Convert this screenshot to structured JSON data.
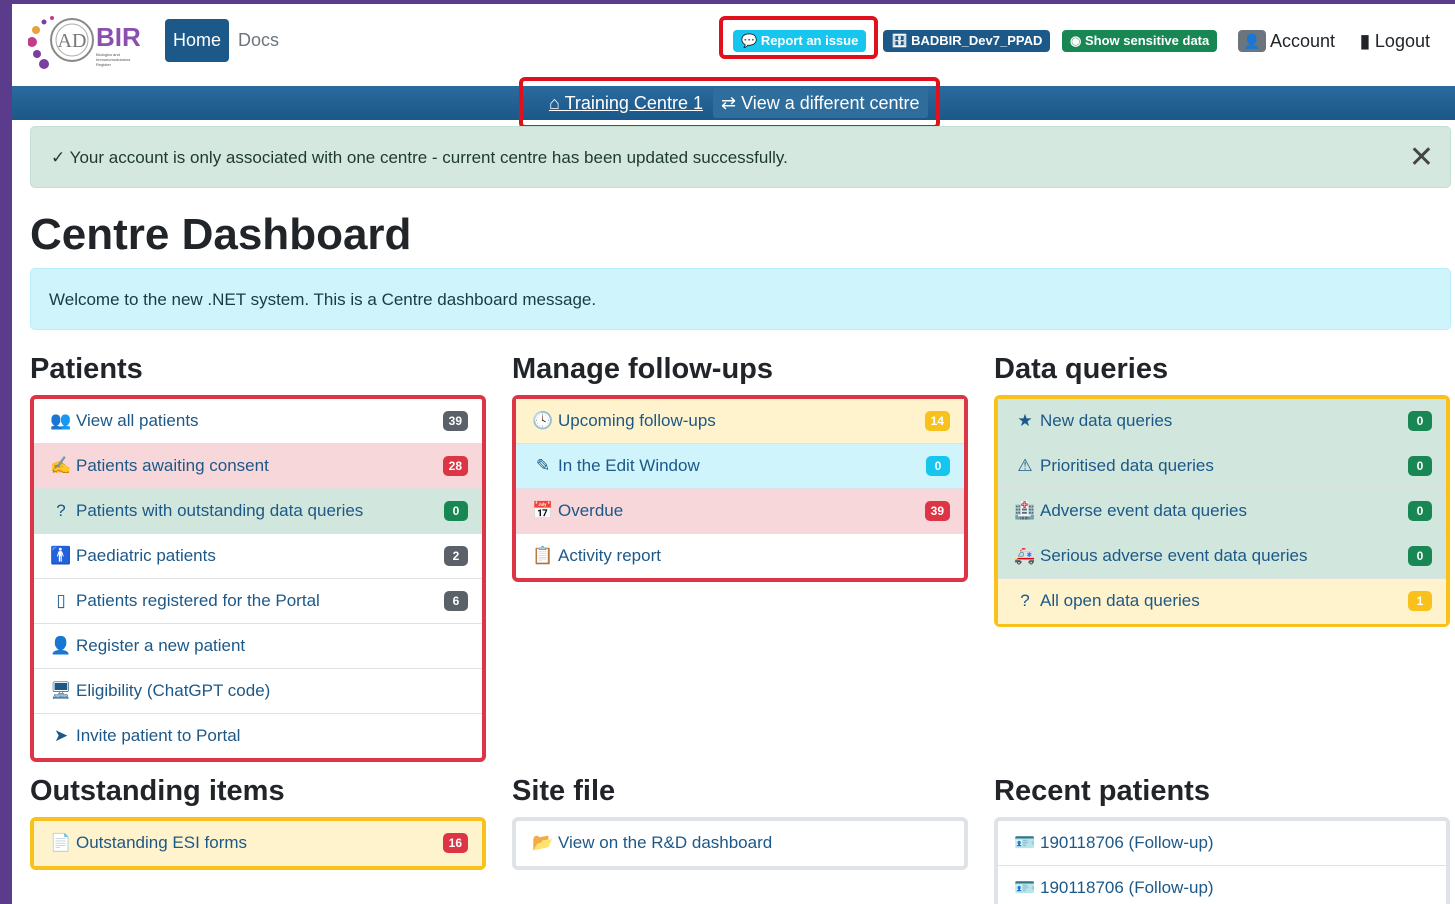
{
  "nav": {
    "logo_text": "BIR",
    "logo_sub": "Biologics and Immunomodulators Register",
    "home": "Home",
    "docs": "Docs",
    "report": "Report an issue",
    "database": "BADBIR_Dev7_PPAD",
    "sensitive": "Show sensitive data",
    "account": "Account",
    "logout": "Logout"
  },
  "centre": {
    "current": "Training Centre 1",
    "switch": "View a different centre"
  },
  "alert": {
    "message": "Your account is only associated with one centre - current centre has been updated successfully.",
    "close": "✕"
  },
  "page_title": "Centre Dashboard",
  "info_message": "Welcome to the new .NET system. This is a Centre dashboard message.",
  "patients": {
    "title": "Patients",
    "items": [
      {
        "label": "View all patients",
        "count": "39"
      },
      {
        "label": "Patients awaiting consent",
        "count": "28"
      },
      {
        "label": "Patients with outstanding data queries",
        "count": "0"
      },
      {
        "label": "Paediatric patients",
        "count": "2"
      },
      {
        "label": "Patients registered for the Portal",
        "count": "6"
      },
      {
        "label": "Register a new patient"
      },
      {
        "label": "Eligibility (ChatGPT code)"
      },
      {
        "label": "Invite patient to Portal"
      }
    ]
  },
  "followups": {
    "title": "Manage follow-ups",
    "items": [
      {
        "label": "Upcoming follow-ups",
        "count": "14"
      },
      {
        "label": "In the Edit Window",
        "count": "0"
      },
      {
        "label": "Overdue",
        "count": "39"
      },
      {
        "label": "Activity report"
      }
    ]
  },
  "queries": {
    "title": "Data queries",
    "items": [
      {
        "label": "New data queries",
        "count": "0"
      },
      {
        "label": "Prioritised data queries",
        "count": "0"
      },
      {
        "label": "Adverse event data queries",
        "count": "0"
      },
      {
        "label": "Serious adverse event data queries",
        "count": "0"
      },
      {
        "label": "All open data queries",
        "count": "1"
      }
    ]
  },
  "outstanding": {
    "title": "Outstanding items",
    "items": [
      {
        "label": "Outstanding ESI forms",
        "count": "16"
      }
    ]
  },
  "sitefile": {
    "title": "Site file",
    "items": [
      {
        "label": "View on the R&D dashboard"
      }
    ]
  },
  "recent": {
    "title": "Recent patients",
    "items": [
      {
        "label": "190118706 (Follow-up)"
      },
      {
        "label": "190118706 (Follow-up)"
      }
    ]
  },
  "colors": {
    "brand": "#1c5888",
    "danger": "#dc3545",
    "success": "#198754",
    "warning": "#f8c11b",
    "highlight": "#e0101d"
  }
}
